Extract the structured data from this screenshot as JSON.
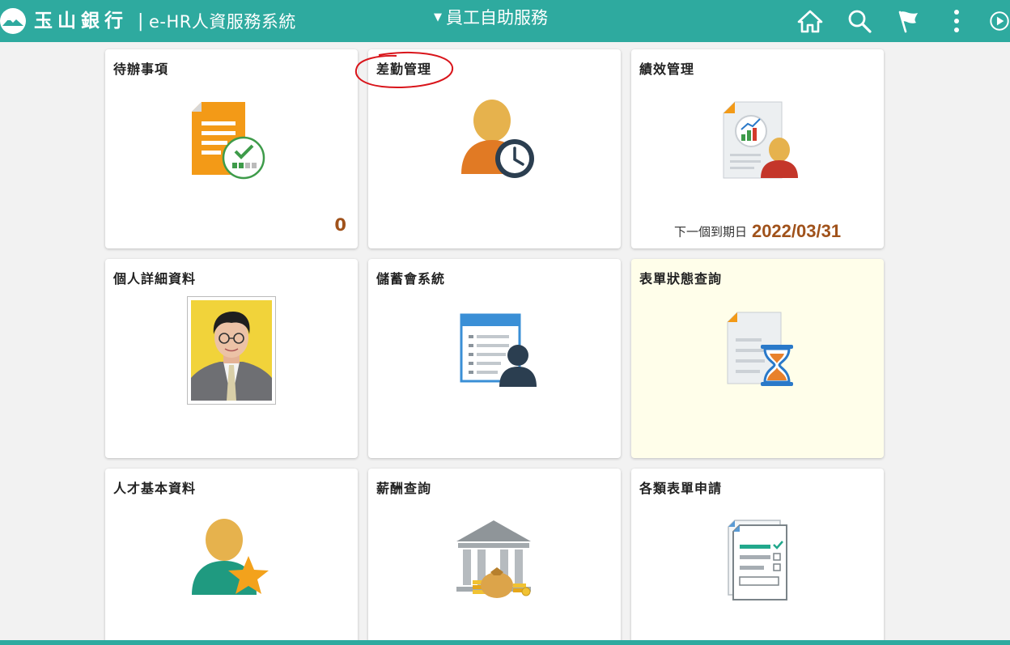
{
  "header": {
    "bank_name": "玉山銀行",
    "separator": "|",
    "app_title": "e-HR人資服務系統",
    "menu_title": "員工自助服務",
    "icons": [
      "home-icon",
      "search-icon",
      "flag-icon",
      "more-vertical-icon",
      "play-icon"
    ]
  },
  "tiles": [
    {
      "title": "待辦事項",
      "count": "0",
      "icon": "task-document-icon"
    },
    {
      "title": "差勤管理",
      "icon": "attendance-clock-icon"
    },
    {
      "title": "績效管理",
      "icon": "performance-report-icon",
      "due_label": "下一個到期日",
      "due_date": "2022/03/31"
    },
    {
      "title": "個人詳細資料",
      "icon": "profile-photo"
    },
    {
      "title": "儲蓄會系統",
      "icon": "savings-list-icon"
    },
    {
      "title": "表單狀態查詢",
      "icon": "form-status-hourglass-icon"
    },
    {
      "title": "人才基本資料",
      "icon": "talent-star-icon"
    },
    {
      "title": "薪酬查詢",
      "icon": "bank-money-icon"
    },
    {
      "title": "各類表單申請",
      "icon": "form-checklist-icon"
    }
  ],
  "colors": {
    "header_bg": "#2eaa9f",
    "accent_number": "#a0521b",
    "highlight_tile_bg": "#fffeea",
    "annotation": "#d9151b"
  }
}
